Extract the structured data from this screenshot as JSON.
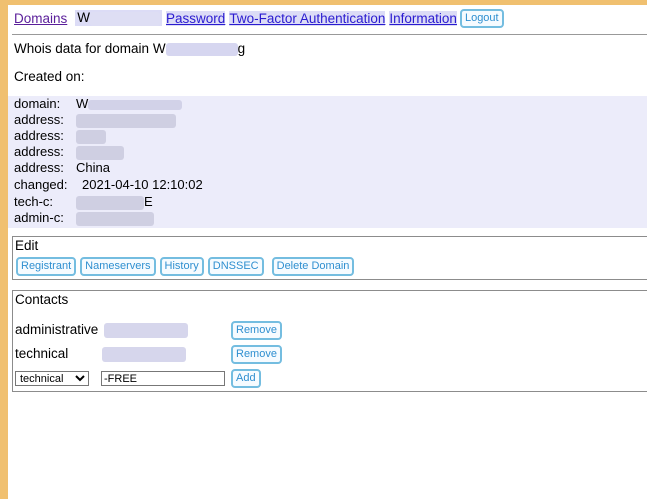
{
  "nav": {
    "domains": "Domains",
    "domain_prefix": "W",
    "password": "Password",
    "two_factor": "Two-Factor Authentication",
    "information": "Information",
    "logout": "Logout"
  },
  "whois_heading": "Whois data for domain W",
  "whois_heading_tail": "g",
  "created_on": "Created on:",
  "whois": [
    {
      "key": "domain:",
      "value": "W"
    },
    {
      "key": "address:",
      "value": ""
    },
    {
      "key": "address:",
      "value": ""
    },
    {
      "key": "address:",
      "value": ""
    },
    {
      "key": "address:",
      "value": "China"
    },
    {
      "key": "changed:",
      "value": "2021-04-10 12:10:02"
    },
    {
      "key": "tech-c:",
      "value": "E"
    },
    {
      "key": "admin-c:",
      "value": ""
    }
  ],
  "edit": {
    "title": "Edit",
    "buttons": [
      "Registrant",
      "Nameservers",
      "History",
      "DNSSEC",
      "Delete Domain"
    ]
  },
  "contacts": {
    "title": "Contacts",
    "rows": [
      {
        "role": "administrative",
        "remove": "Remove"
      },
      {
        "role": "technical",
        "remove": "Remove"
      }
    ],
    "add_row": {
      "select_value": "technical",
      "select_options": [
        "technical"
      ],
      "input_value": "-FREE",
      "add": "Add"
    }
  },
  "colors": {
    "link": "#2a1bd0",
    "visited": "#5a1e9a",
    "button": "#2f8fd0",
    "whois_bg": "#ececfa",
    "sidebar": "#f0c070"
  }
}
